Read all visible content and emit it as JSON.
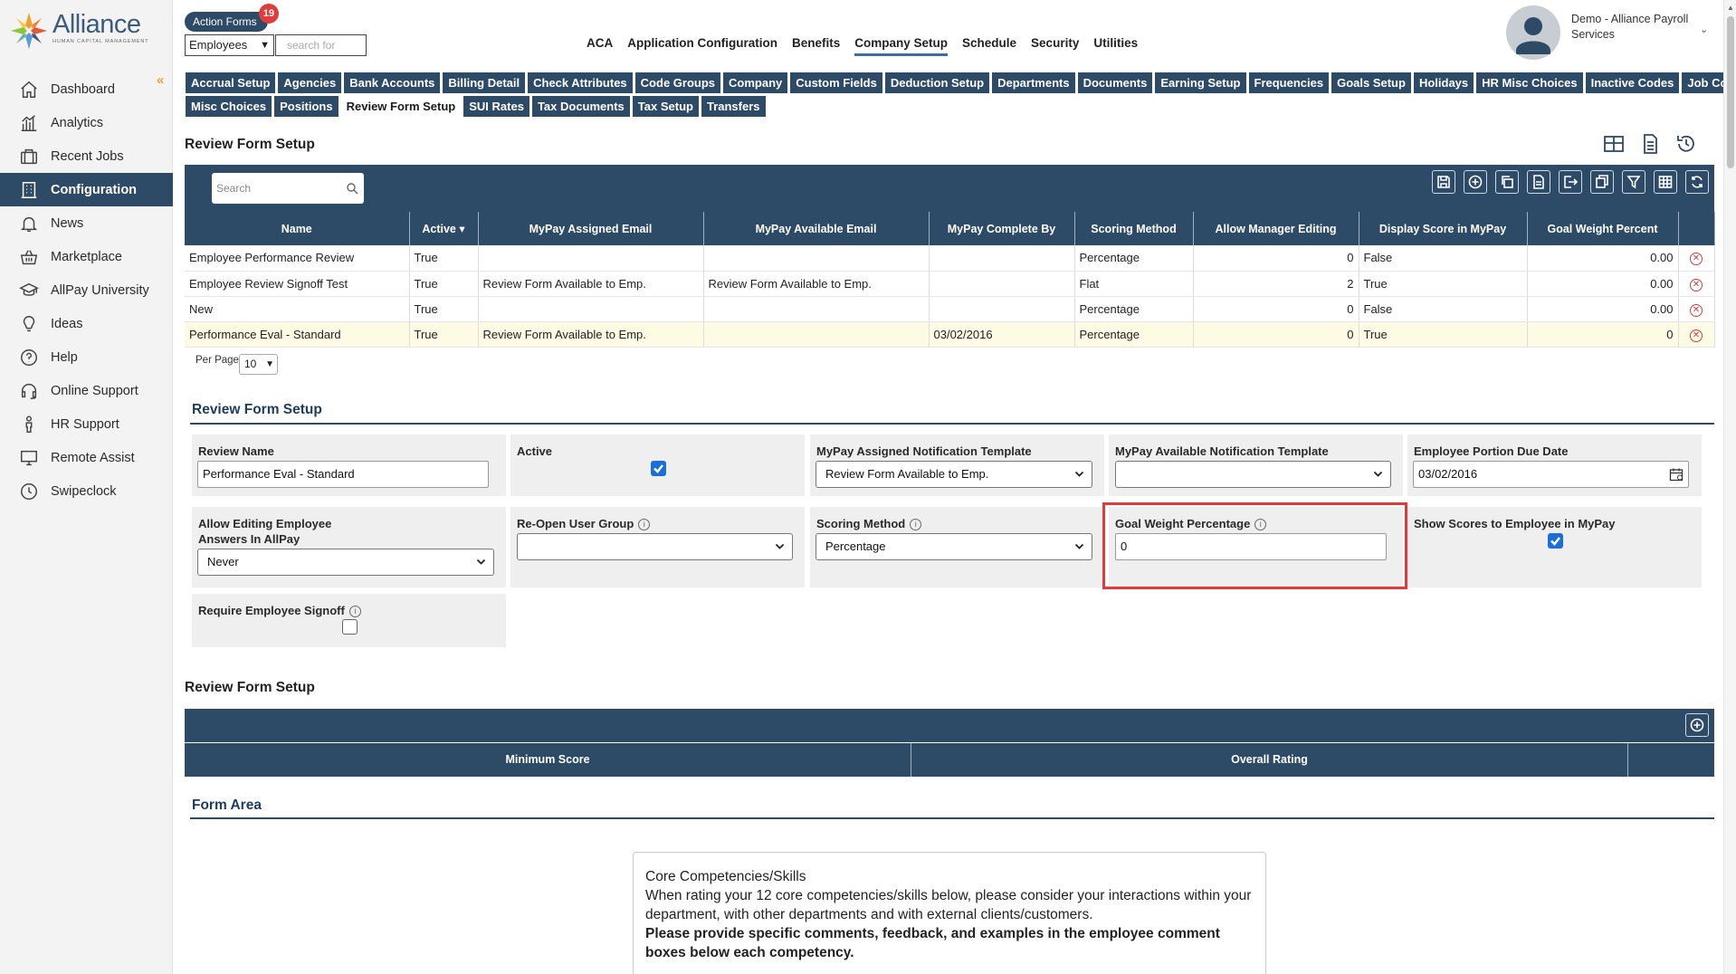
{
  "logo": {
    "name": "Alliance",
    "sub": "HUMAN CAPITAL MANAGEMENT"
  },
  "sidebar": {
    "items": [
      {
        "label": "Dashboard",
        "icon": "home-icon"
      },
      {
        "label": "Analytics",
        "icon": "analytics-icon"
      },
      {
        "label": "Recent Jobs",
        "icon": "briefcase-icon"
      },
      {
        "label": "Configuration",
        "icon": "building-icon",
        "active": true
      },
      {
        "label": "News",
        "icon": "bell-icon"
      },
      {
        "label": "Marketplace",
        "icon": "basket-icon"
      },
      {
        "label": "AllPay University",
        "icon": "graduation-cap-icon"
      },
      {
        "label": "Ideas",
        "icon": "lightbulb-icon"
      },
      {
        "label": "Help",
        "icon": "question-icon"
      },
      {
        "label": "Online Support",
        "icon": "headset-icon"
      },
      {
        "label": "HR Support",
        "icon": "person-icon"
      },
      {
        "label": "Remote Assist",
        "icon": "monitor-icon"
      },
      {
        "label": "Swipeclock",
        "icon": "clock-icon"
      }
    ]
  },
  "topbar": {
    "action_forms_label": "Action Forms",
    "action_forms_count": "19",
    "module_select": "Employees",
    "search_placeholder": "search for",
    "menu": [
      "ACA",
      "Application Configuration",
      "Benefits",
      "Company Setup",
      "Schedule",
      "Security",
      "Utilities"
    ],
    "active_menu": "Company Setup",
    "user_name": "Demo - Alliance Payroll Services"
  },
  "tabs": {
    "row1": [
      "Accrual Setup",
      "Agencies",
      "Bank Accounts",
      "Billing Detail",
      "Check Attributes",
      "Code Groups",
      "Company",
      "Custom Fields",
      "Deduction Setup",
      "Departments",
      "Documents",
      "Earning Setup",
      "Frequencies",
      "Goals Setup",
      "Holidays",
      "HR Misc Choices",
      "Inactive Codes",
      "Job Codes"
    ],
    "row2": [
      "Misc Choices",
      "Positions",
      "Review Form Setup",
      "SUI Rates",
      "Tax Documents",
      "Tax Setup",
      "Transfers"
    ],
    "active": "Review Form Setup"
  },
  "page": {
    "title": "Review Form Setup"
  },
  "grid": {
    "search_placeholder": "Search",
    "columns": [
      "Name",
      "Active",
      "MyPay Assigned Email",
      "MyPay Available Email",
      "MyPay Complete By",
      "Scoring Method",
      "Allow Manager Editing",
      "Display Score in MyPay",
      "Goal Weight Percent",
      ""
    ],
    "rows": [
      [
        "Employee Performance Review",
        "True",
        "",
        "",
        "",
        "Percentage",
        "0",
        "False",
        "0.00"
      ],
      [
        "Employee Review Signoff Test",
        "True",
        "Review Form Available to Emp.",
        "Review Form Available to Emp.",
        "",
        "Flat",
        "2",
        "True",
        "0.00"
      ],
      [
        "New",
        "True",
        "",
        "",
        "",
        "Percentage",
        "0",
        "False",
        "0.00"
      ],
      [
        "Performance Eval - Standard",
        "True",
        "Review Form Available to Emp.",
        "",
        "03/02/2016",
        "Percentage",
        "0",
        "True",
        "0"
      ]
    ],
    "selected_row": 3,
    "per_page_label": "Per Page",
    "per_page_value": "10"
  },
  "form": {
    "section_title": "Review Form Setup",
    "review_name_label": "Review Name",
    "review_name_value": "Performance Eval - Standard",
    "active_label": "Active",
    "active_checked": true,
    "assigned_tpl_label": "MyPay Assigned Notification Template",
    "assigned_tpl_value": "Review Form Available to Emp.",
    "available_tpl_label": "MyPay Available Notification Template",
    "available_tpl_value": "",
    "due_date_label": "Employee Portion Due Date",
    "due_date_value": "03/02/2016",
    "allow_editing_label_1": "Allow Editing Employee",
    "allow_editing_label_2": "Answers In AllPay",
    "allow_editing_value": "Never",
    "reopen_label": "Re-Open User Group",
    "reopen_value": "",
    "scoring_label": "Scoring Method",
    "scoring_value": "Percentage",
    "goal_weight_label": "Goal Weight Percentage",
    "goal_weight_value": "0",
    "show_scores_label": "Show Scores to Employee in MyPay",
    "show_scores_checked": true,
    "require_signoff_label": "Require Employee Signoff",
    "require_signoff_checked": false
  },
  "rating": {
    "section_title": "Review Form Setup",
    "columns": [
      "Minimum Score",
      "Overall Rating"
    ]
  },
  "form_area": {
    "section_title": "Form Area",
    "heading": "Core Competencies/Skills",
    "body": "When rating your 12 core competencies/skills below, please consider your interactions within your department, with other departments and with external clients/customers.",
    "bold_text": "Please provide specific comments, feedback, and examples in the employee comment boxes below each competency."
  },
  "colors": {
    "primary": "#2d4a66",
    "accent": "#f0a030",
    "alert": "#e53939",
    "checkbox": "#1a6fd8"
  }
}
